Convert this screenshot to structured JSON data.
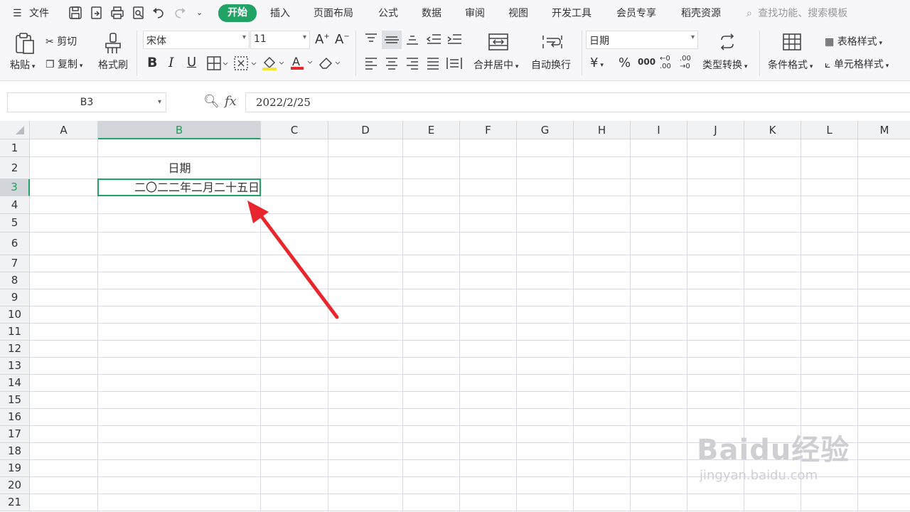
{
  "menu": {
    "file": "文件",
    "tabs": [
      "开始",
      "插入",
      "页面布局",
      "公式",
      "数据",
      "审阅",
      "视图",
      "开发工具",
      "会员专享",
      "稻壳资源"
    ],
    "search": "查找功能、搜索模板"
  },
  "ribbon": {
    "paste": "粘贴",
    "cut": "剪切",
    "copy": "复制",
    "format_painter": "格式刷",
    "font_name": "宋体",
    "font_size": "11",
    "merge_center": "合并居中",
    "wrap_text": "自动换行",
    "number_format": "日期",
    "percent": "%",
    "thousands": "000",
    "convert_type": "类型转换",
    "conditional_format": "条件格式",
    "table_style": "表格样式",
    "cell_style": "单元格样式"
  },
  "formula_bar": {
    "name_box": "B3",
    "fx": "fx",
    "value": "2022/2/25"
  },
  "sheet": {
    "columns": [
      "A",
      "B",
      "C",
      "D",
      "E",
      "F",
      "G",
      "H",
      "I",
      "J",
      "K",
      "L",
      "M"
    ],
    "rows": [
      "1",
      "2",
      "3",
      "4",
      "5",
      "6",
      "7",
      "8",
      "9",
      "10",
      "11",
      "12",
      "13",
      "14",
      "15",
      "16",
      "17",
      "18",
      "19",
      "20",
      "21"
    ],
    "selected_cell": "B3",
    "B2": "日期",
    "B3": "二〇二二年二月二十五日"
  },
  "watermark": {
    "brand": "Baidu经验",
    "url": "jingyan.baidu.com"
  },
  "colors": {
    "accent": "#21a366",
    "arrow": "#e8262d"
  }
}
